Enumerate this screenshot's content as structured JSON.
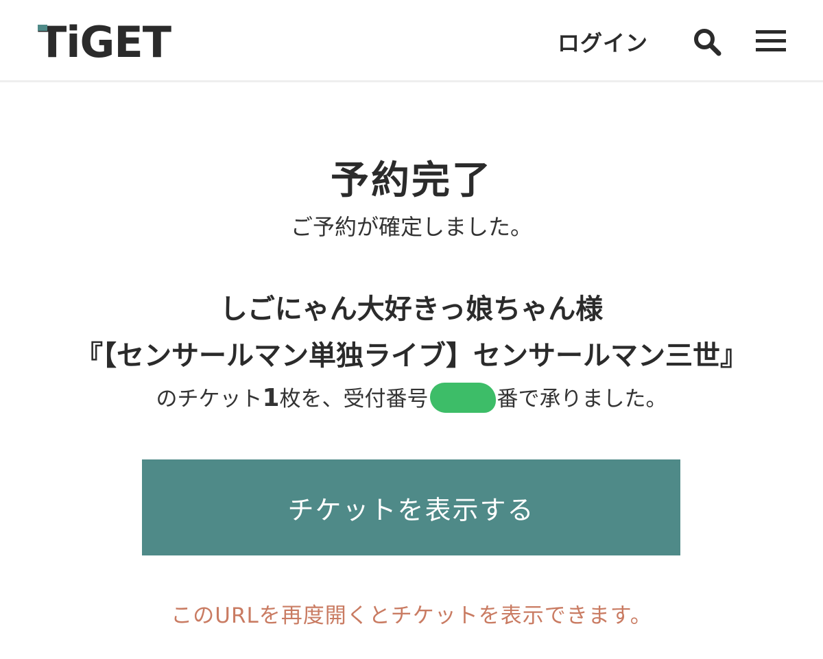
{
  "header": {
    "logo_text": "TiGET",
    "login_label": "ログイン",
    "search_icon": "search-icon",
    "menu_icon": "hamburger-menu-icon",
    "accent_color": "#4f8a88"
  },
  "main": {
    "title": "予約完了",
    "subtitle": "ご予約が確定しました。",
    "customer_line": "しごにゃん大好きっ娘ちゃん様",
    "event_line": "『【センサールマン単独ライブ】センサールマン三世』",
    "ticket_prefix": "のチケット",
    "ticket_count": "1",
    "ticket_middle": "枚を、受付番号",
    "ticket_suffix": "番で承りました。",
    "show_ticket_button": "チケットを表示する",
    "note": "このURLを再度開くとチケットを表示できます。",
    "button_color": "#4f8a88",
    "note_color": "#c97b62"
  }
}
